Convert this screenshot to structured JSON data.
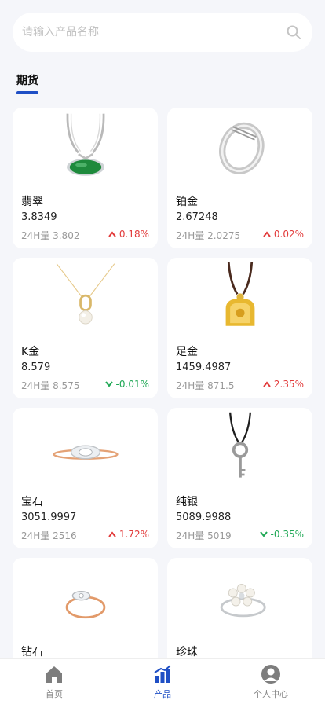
{
  "search": {
    "placeholder": "请输入产品名称",
    "icon": "search-icon"
  },
  "section": {
    "title": "期货",
    "accent": "#1f4fc5"
  },
  "products": [
    {
      "name": "翡翠",
      "price": "3.8349",
      "volume": "24H量 3.802",
      "change": "0.18%",
      "direction": "up",
      "image": "jade-necklace"
    },
    {
      "name": "铂金",
      "price": "2.67248",
      "volume": "24H量 2.0275",
      "change": "0.02%",
      "direction": "up",
      "image": "platinum-ring"
    },
    {
      "name": "K金",
      "price": "8.579",
      "volume": "24H量 8.575",
      "change": "-0.01%",
      "direction": "down",
      "image": "pearl-pendant-necklace"
    },
    {
      "name": "足金",
      "price": "1459.4987",
      "volume": "24H量 871.5",
      "change": "2.35%",
      "direction": "up",
      "image": "gold-lock-pendant"
    },
    {
      "name": "宝石",
      "price": "3051.9997",
      "volume": "24H量 2516",
      "change": "1.72%",
      "direction": "up",
      "image": "gemstone-ring"
    },
    {
      "name": "纯银",
      "price": "5089.9988",
      "volume": "24H量 5019",
      "change": "-0.35%",
      "direction": "down",
      "image": "silver-key-pendant"
    },
    {
      "name": "钻石",
      "image": "diamond-ring"
    },
    {
      "name": "珍珠",
      "image": "pearl-flower-ring"
    }
  ],
  "colors": {
    "up": "#e23b3b",
    "down": "#1fa855",
    "active": "#1f4fc5"
  },
  "tabbar": [
    {
      "label": "首页",
      "icon": "home-icon",
      "active": false
    },
    {
      "label": "产品",
      "icon": "chart-icon",
      "active": true
    },
    {
      "label": "个人中心",
      "icon": "user-icon",
      "active": false
    }
  ]
}
